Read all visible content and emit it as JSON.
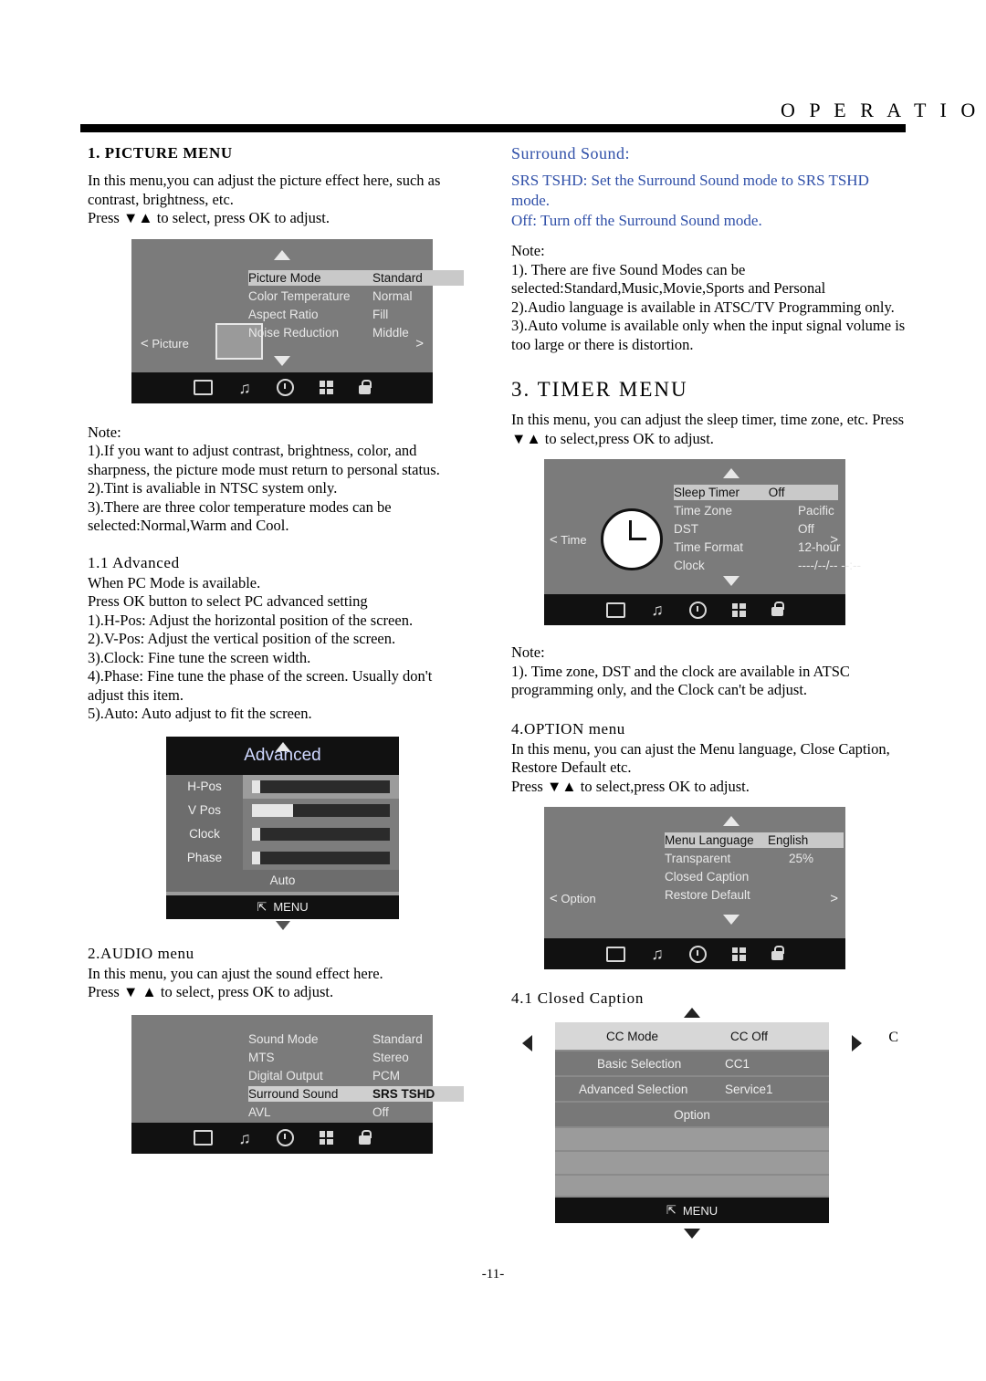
{
  "header": {
    "title": "O P E R A T I O N"
  },
  "page_number": "-11-",
  "left": {
    "picture_menu": {
      "heading": "1. PICTURE MENU",
      "intro": "In this menu,you can adjust the picture effect here, such as contrast, brightness, etc.",
      "press": "Press ▼▲ to select, press OK to adjust.",
      "osd": {
        "side_label": "Picture",
        "rows": [
          {
            "label": "Picture Mode",
            "value": "Standard",
            "highlight": true
          },
          {
            "label": "Color Temperature",
            "value": "Normal",
            "highlight": false
          },
          {
            "label": "Aspect Ratio",
            "value": "Fill",
            "highlight": false
          },
          {
            "label": "Noise Reduction",
            "value": "Middle",
            "highlight": false
          }
        ]
      },
      "note_title": "Note:",
      "notes": [
        "1).If you want to adjust contrast, brightness, color, and sharpness, the picture mode must return to personal status.",
        "2).Tint is avaliable in NTSC system only.",
        "3).There are three color temperature modes can be selected:Normal,Warm and Cool."
      ]
    },
    "advanced": {
      "heading": "1.1 Advanced",
      "lines": [
        "When PC Mode is available.",
        "Press OK button to select PC advanced setting",
        "1).H-Pos: Adjust the horizontal position of the screen.",
        "2).V-Pos: Adjust the vertical position of the screen.",
        "3).Clock: Fine tune the screen width.",
        "4).Phase: Fine tune the phase of the screen. Usually don't adjust this item.",
        "5).Auto: Auto adjust to fit the screen."
      ],
      "panel": {
        "title": "Advanced",
        "rows": [
          {
            "label": "H-Pos",
            "fill": 6,
            "highlight": true
          },
          {
            "label": "V Pos",
            "fill": 30,
            "highlight": false
          },
          {
            "label": "Clock",
            "fill": 6,
            "highlight": false
          },
          {
            "label": "Phase",
            "fill": 6,
            "highlight": false
          }
        ],
        "auto_label": "Auto",
        "menu_label": "MENU"
      }
    },
    "audio_menu": {
      "heading": "2.AUDIO menu",
      "intro": "In this menu, you can ajust the sound effect here.",
      "press": "Press ▼ ▲ to select, press OK to adjust.",
      "osd": {
        "rows": [
          {
            "label": "Sound Mode",
            "value": "Standard",
            "highlight": false
          },
          {
            "label": "MTS",
            "value": "Stereo",
            "highlight": false
          },
          {
            "label": "Digital Output",
            "value": "PCM",
            "highlight": false
          },
          {
            "label": "Surround Sound",
            "value": "SRS TSHD",
            "highlight": true
          },
          {
            "label": "AVL",
            "value": "Off",
            "highlight": false
          }
        ]
      }
    }
  },
  "right": {
    "surround": {
      "heading": "Surround Sound:",
      "line1": "SRS TSHD: Set the Surround Sound mode to SRS TSHD mode.",
      "line2": "Off: Turn off the Surround Sound mode.",
      "note_title": "Note:",
      "notes": [
        "1). There are five Sound Modes can be selected:Standard,Music,Movie,Sports and Personal",
        "2).Audio language is available in ATSC/TV Programming only.",
        "3).Auto volume is available only when the input signal volume is too large or there is distortion."
      ]
    },
    "timer_menu": {
      "heading": "3. TIMER MENU",
      "intro": "In this menu, you can adjust the sleep timer, time zone, etc. Press ▼▲ to select,press OK to adjust.",
      "osd": {
        "side_label": "Time",
        "rows": [
          {
            "label": "Sleep Timer",
            "value": "Off",
            "highlight": true
          },
          {
            "label": "Time Zone",
            "value": "Pacific",
            "highlight": false
          },
          {
            "label": "DST",
            "value": "Off",
            "highlight": false
          },
          {
            "label": "Time Format",
            "value": "12-hour",
            "highlight": false
          },
          {
            "label": "Clock",
            "value": "----/--/-- --:--",
            "highlight": false
          }
        ]
      },
      "note_title": "Note:",
      "notes": [
        "1). Time zone, DST and the clock are available in ATSC programming only, and the Clock can't be adjust."
      ]
    },
    "option_menu": {
      "heading": "4.OPTION menu",
      "intro": "In this menu, you can ajust the Menu language, Close Caption, Restore Default etc.",
      "press": "Press ▼▲ to select,press OK to adjust.",
      "osd": {
        "side_label": "Option",
        "rows": [
          {
            "label": "Menu Language",
            "value": "English",
            "highlight": true
          },
          {
            "label": "Transparent",
            "value": "25%",
            "highlight": false
          },
          {
            "label": "Closed Caption",
            "value": "",
            "highlight": false
          },
          {
            "label": "Restore Default",
            "value": "",
            "highlight": false
          }
        ]
      }
    },
    "closed_caption": {
      "heading": "4.1  Closed Caption",
      "right_marker": "C",
      "panel": {
        "rows": [
          {
            "label": "CC Mode",
            "value": "CC Off",
            "style": "top"
          },
          {
            "label": "Basic Selection",
            "value": "CC1",
            "style": "mid"
          },
          {
            "label": "Advanced Selection",
            "value": "Service1",
            "style": "mid"
          },
          {
            "label": "Option",
            "value": "",
            "style": "center"
          }
        ],
        "menu_label": "MENU"
      }
    }
  }
}
